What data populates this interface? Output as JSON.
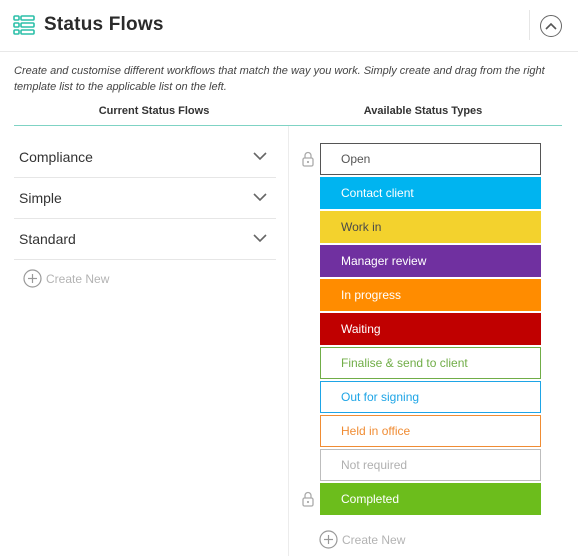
{
  "header": {
    "title": "Status Flows",
    "icon": "list-settings-icon",
    "collapse_icon": "chevron-up-icon",
    "accent": "#2bbfa8"
  },
  "description": "Create and customise different workflows that match the way you work. Simply create and drag from the right template list to the applicable list on the left.",
  "columns": {
    "current": "Current Status Flows",
    "available": "Available Status Types"
  },
  "flows": [
    {
      "label": "Compliance"
    },
    {
      "label": "Simple"
    },
    {
      "label": "Standard"
    }
  ],
  "create_new_label": "Create New",
  "statuses": [
    {
      "label": "Open",
      "fill": "#ffffff",
      "border": "#555555",
      "text": "#555555",
      "locked": true
    },
    {
      "label": "Contact client",
      "fill": "#00b4f0",
      "border": "#00b4f0",
      "text": "#ffffff",
      "locked": false
    },
    {
      "label": "Work in",
      "fill": "#f3d22d",
      "border": "#f3d22d",
      "text": "#4a4a4a",
      "locked": false
    },
    {
      "label": "Manager review",
      "fill": "#7030a0",
      "border": "#7030a0",
      "text": "#ffffff",
      "locked": false
    },
    {
      "label": "In progress",
      "fill": "#ff8c00",
      "border": "#ff8c00",
      "text": "#ffffff",
      "locked": false
    },
    {
      "label": "Waiting",
      "fill": "#c00000",
      "border": "#c00000",
      "text": "#ffffff",
      "locked": false
    },
    {
      "label": "Finalise & send to client",
      "fill": "#ffffff",
      "border": "#70ad47",
      "text": "#70ad47",
      "locked": false
    },
    {
      "label": "Out for signing",
      "fill": "#ffffff",
      "border": "#1ea5e6",
      "text": "#1ea5e6",
      "locked": false
    },
    {
      "label": "Held in office",
      "fill": "#ffffff",
      "border": "#f08c33",
      "text": "#f08c33",
      "locked": false
    },
    {
      "label": "Not required",
      "fill": "#ffffff",
      "border": "#bdbdbd",
      "text": "#b0b0b0",
      "locked": false
    },
    {
      "label": "Completed",
      "fill": "#6cbd1c",
      "border": "#6cbd1c",
      "text": "#ffffff",
      "locked": true
    }
  ]
}
